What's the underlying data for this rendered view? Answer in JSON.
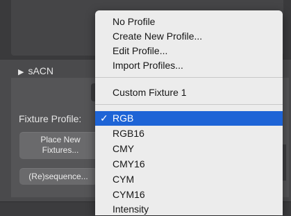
{
  "panel": {
    "section_title": "sACN",
    "fixture_profile_label": "Fixture Profile:",
    "place_button": {
      "line1": "Place New",
      "line2": "Fixtures..."
    },
    "sequence_button": "(Re)sequence..."
  },
  "menu": {
    "group1": [
      {
        "label": "No Profile"
      },
      {
        "label": "Create New Profile..."
      },
      {
        "label": "Edit Profile..."
      },
      {
        "label": "Import Profiles..."
      }
    ],
    "custom": [
      {
        "label": "Custom Fixture 1"
      }
    ],
    "profiles": [
      {
        "label": "RGB",
        "selected": true,
        "check": "✓"
      },
      {
        "label": "RGB16"
      },
      {
        "label": "CMY"
      },
      {
        "label": "CMY16"
      },
      {
        "label": "CYM"
      },
      {
        "label": "CYM16"
      },
      {
        "label": "Intensity"
      }
    ]
  },
  "colors": {
    "highlight": "#1e64d6",
    "menu_background": "#ececec",
    "panel_background": "#4a4a4c"
  }
}
